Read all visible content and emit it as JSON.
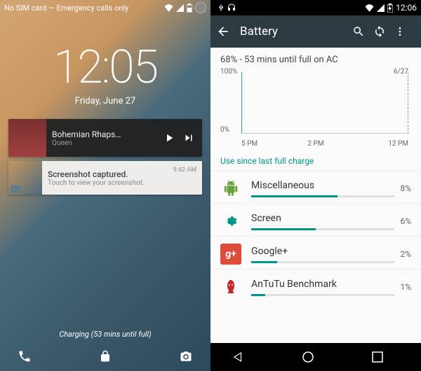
{
  "left": {
    "status_text": "No SIM card — Emergency calls only",
    "clock": {
      "time": "12:05",
      "date": "Friday, June 27"
    },
    "music": {
      "title": "Bohemian Rhaps…",
      "artist": "Queen"
    },
    "screenshot": {
      "title": "Screenshot captured.",
      "sub": "Touch to view your screenshot.",
      "time": "9:42 AM"
    },
    "charging": "Charging (53 mins until full)"
  },
  "right": {
    "status_time": "12:06",
    "appbar_title": "Battery",
    "summary": "68% - 53 mins until full on AC",
    "since_label": "Use since last full charge",
    "items": [
      {
        "name": "Miscellaneous",
        "pct": "8%"
      },
      {
        "name": "Screen",
        "pct": "6%"
      },
      {
        "name": "Google+",
        "pct": "2%"
      },
      {
        "name": "AnTuTu Benchmark",
        "pct": "1%"
      }
    ]
  },
  "chart_data": {
    "type": "line",
    "title": "",
    "xlabel": "",
    "ylabel": "",
    "ylim": [
      0,
      100
    ],
    "y_ticks": [
      "100%",
      "0%"
    ],
    "x_ticks": [
      "5 PM",
      "2 PM",
      "12 PM"
    ],
    "date_end": "6/27",
    "series": [
      {
        "name": "battery",
        "x": [
          "5 PM"
        ],
        "values": [
          100
        ]
      }
    ],
    "note": "Single data point at start; projection dashed to 6/27 12 PM"
  }
}
